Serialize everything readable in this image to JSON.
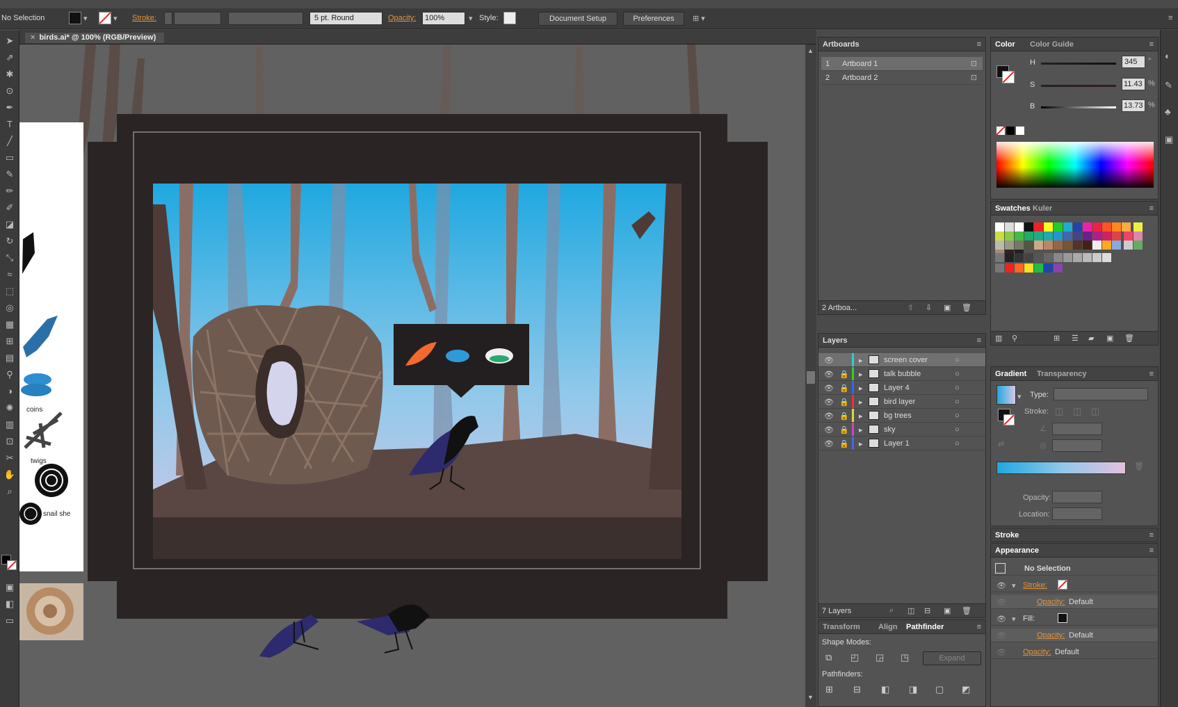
{
  "control_bar": {
    "selection": "No Selection",
    "stroke_label": "Stroke:",
    "brush": "5 pt. Round",
    "opacity_label": "Opacity:",
    "opacity_value": "100%",
    "style_label": "Style:",
    "document_setup": "Document Setup",
    "preferences": "Preferences"
  },
  "document": {
    "tab_title": "birds.ai* @ 100% (RGB/Preview)",
    "labels": {
      "coins": "coins",
      "twigs": "twigs",
      "snail": "snail she"
    }
  },
  "artboards": {
    "title": "Artboards",
    "items": [
      {
        "num": "1",
        "name": "Artboard 1"
      },
      {
        "num": "2",
        "name": "Artboard 2"
      }
    ],
    "footer": "2 Artboa..."
  },
  "layers": {
    "title": "Layers",
    "items": [
      {
        "name": "screen cover",
        "color": "#33cccc"
      },
      {
        "name": "talk bubble",
        "color": "#33cc33"
      },
      {
        "name": "Layer 4",
        "color": "#3366ff"
      },
      {
        "name": "bird layer",
        "color": "#ee3333"
      },
      {
        "name": "bg trees",
        "color": "#dddd33"
      },
      {
        "name": "sky",
        "color": "#cc44cc"
      },
      {
        "name": "Layer 1",
        "color": "#4466ee"
      }
    ],
    "footer": "7 Layers"
  },
  "transform_tabs": [
    "Transform",
    "Align",
    "Pathfinder"
  ],
  "pathfinder": {
    "shape_modes": "Shape Modes:",
    "expand": "Expand",
    "pathfinders": "Pathfinders:"
  },
  "color": {
    "tabs": [
      "Color",
      "Color Guide"
    ],
    "h_label": "H",
    "h_value": "345",
    "h_unit": "°",
    "s_label": "S",
    "s_value": "11.43",
    "s_unit": "%",
    "b_label": "B",
    "b_value": "13.73",
    "b_unit": "%"
  },
  "swatches": {
    "tabs": [
      "Swatches",
      "Kuler"
    ]
  },
  "gradient": {
    "tabs": [
      "Gradient",
      "Transparency"
    ],
    "type_label": "Type:",
    "stroke_label": "Stroke:",
    "opacity_label": "Opacity:",
    "location_label": "Location:"
  },
  "stroke_panel": {
    "title": "Stroke"
  },
  "appearance": {
    "title": "Appearance",
    "no_selection": "No Selection",
    "stroke": "Stroke:",
    "opacity1": "Opacity:",
    "default1": "Default",
    "fill": "Fill:",
    "opacity2": "Opacity:",
    "default2": "Default",
    "opacity3": "Opacity:",
    "default3": "Default"
  }
}
